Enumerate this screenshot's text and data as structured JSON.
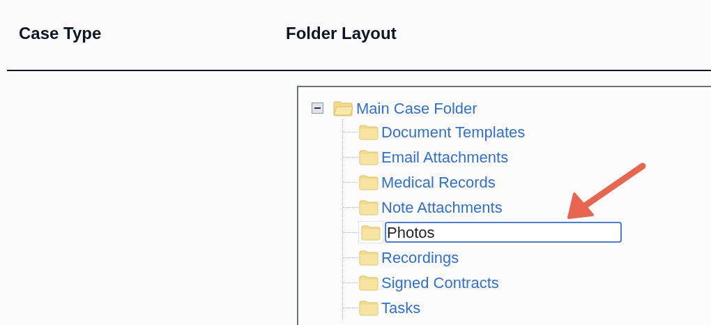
{
  "columns": [
    "Case Type",
    "Folder Layout"
  ],
  "tree": {
    "label": "Main Case Folder",
    "expanded": true,
    "children": [
      {
        "label": "Document Templates",
        "editing": false
      },
      {
        "label": "Email Attachments",
        "editing": false
      },
      {
        "label": "Medical Records",
        "editing": false
      },
      {
        "label": "Note Attachments",
        "editing": false
      },
      {
        "label": "Photos",
        "editing": true
      },
      {
        "label": "Recordings",
        "editing": false
      },
      {
        "label": "Signed Contracts",
        "editing": false
      },
      {
        "label": "Tasks",
        "editing": false
      }
    ]
  }
}
